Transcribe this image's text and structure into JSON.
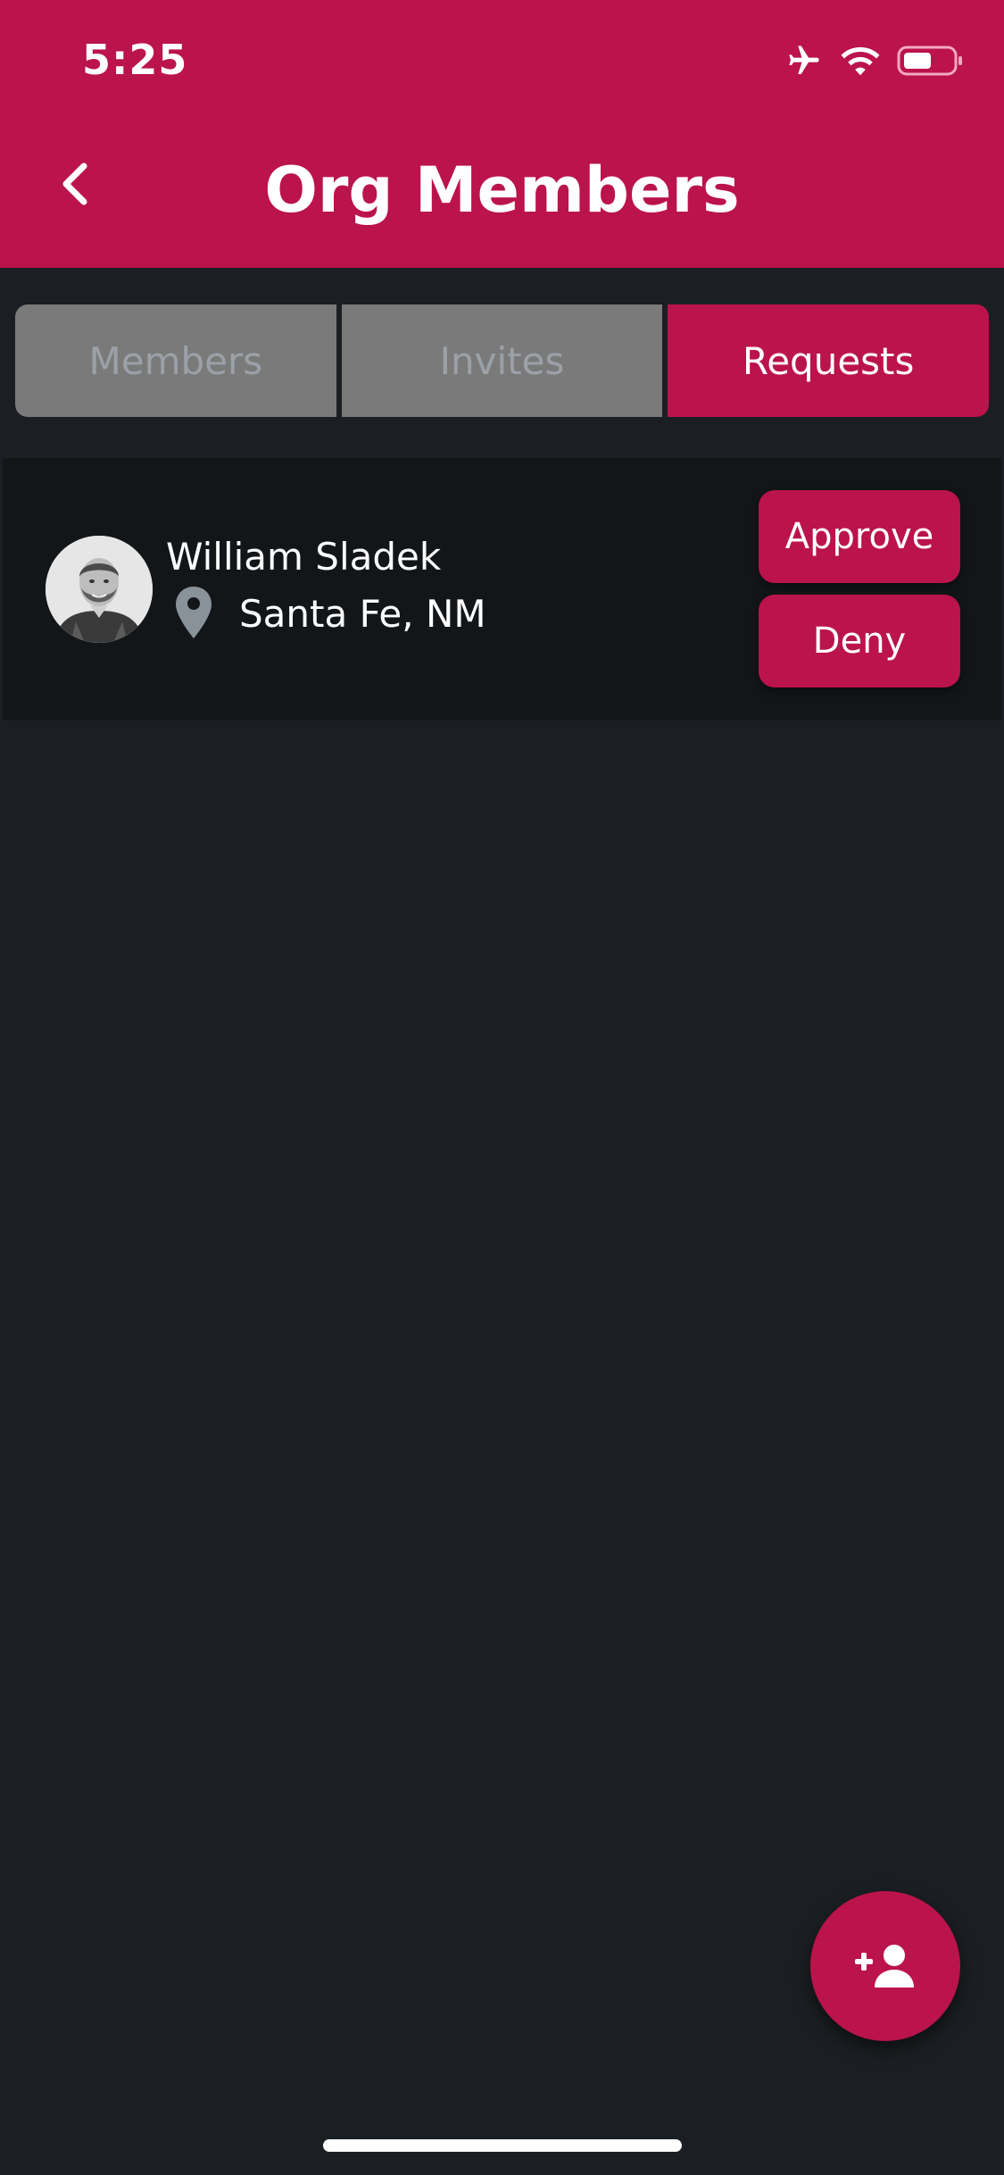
{
  "status_bar": {
    "time": "5:25",
    "icons": [
      "airplane-icon",
      "wifi-icon",
      "battery-icon"
    ]
  },
  "header": {
    "title": "Org Members",
    "back_icon": "chevron-left-icon"
  },
  "tabs": [
    {
      "label": "Members",
      "active": false
    },
    {
      "label": "Invites",
      "active": false
    },
    {
      "label": "Requests",
      "active": true
    }
  ],
  "requests": [
    {
      "name": "William Sladek",
      "location": "Santa Fe, NM",
      "location_icon": "map-pin-icon",
      "actions": {
        "approve_label": "Approve",
        "deny_label": "Deny"
      }
    }
  ],
  "fab": {
    "icon": "add-person-icon"
  },
  "colors": {
    "brand": "#bb134b",
    "background": "#1b1f23",
    "card": "#131619",
    "tab_inactive": "#7a7a7a",
    "tab_inactive_text": "#9ca1a8"
  }
}
